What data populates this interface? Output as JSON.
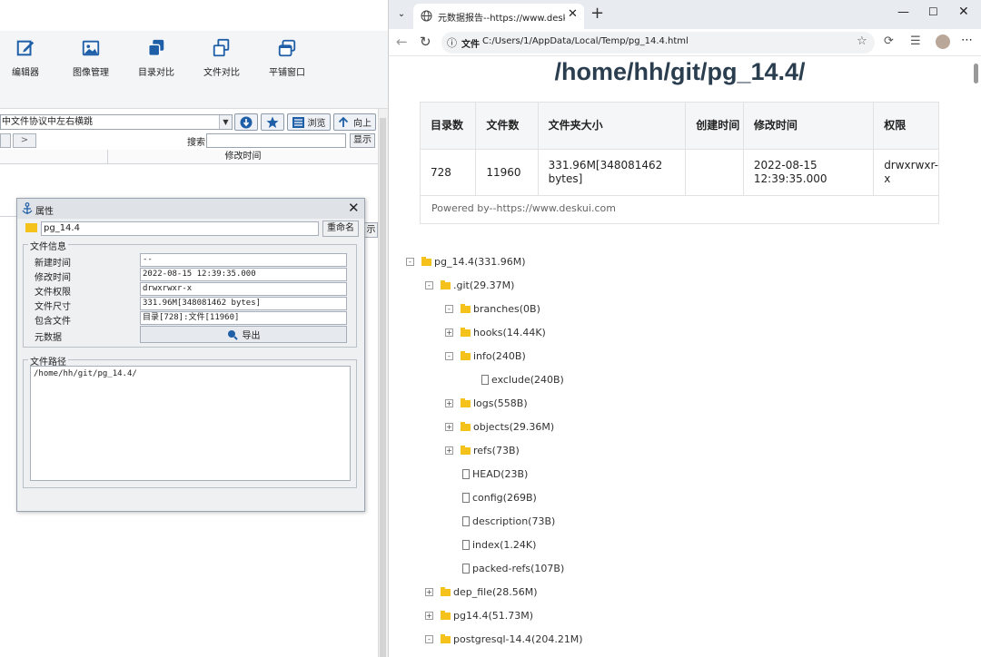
{
  "left_app": {
    "ribbon": [
      {
        "label": "编辑器",
        "icon": "edit-icon"
      },
      {
        "label": "图像管理",
        "icon": "image-icon"
      },
      {
        "label": "目录对比",
        "icon": "folder-compare-icon"
      },
      {
        "label": "文件对比",
        "icon": "file-compare-icon"
      },
      {
        "label": "平铺窗口",
        "icon": "tile-windows-icon"
      }
    ],
    "path_combo": "中文件协议中左右横跳",
    "browse_label": "浏览",
    "up_label": "向上",
    "search_label": "搜索",
    "show_label": "显示",
    "col_modify_time": "修改时间"
  },
  "dialog": {
    "title": "属性",
    "name_value": "pg_14.4",
    "rename_label": "重命名",
    "info_legend": "文件信息",
    "fields": [
      {
        "label": "新建时间",
        "value": "--"
      },
      {
        "label": "修改时间",
        "value": "2022-08-15 12:39:35.000"
      },
      {
        "label": "文件权限",
        "value": "drwxrwxr-x"
      },
      {
        "label": "文件尺寸",
        "value": "331.96M[348081462 bytes]"
      },
      {
        "label": "包含文件",
        "value": "目录[728]:文件[11960]"
      }
    ],
    "metadata_label": "元数据",
    "export_label": "导出",
    "path_legend": "文件路径",
    "path_value": "/home/hh/git/pg_14.4/",
    "side_btn_label": "示"
  },
  "browser": {
    "tab_title": "元数据报告--https://www.deskui.c",
    "address_label": "文件",
    "address": "C:/Users/1/AppData/Local/Temp/pg_14.4.html"
  },
  "report": {
    "heading": "/home/hh/git/pg_14.4/",
    "headers": [
      "目录数",
      "文件数",
      "文件夹大小",
      "创建时间",
      "修改时间",
      "权限"
    ],
    "values": [
      "728",
      "11960",
      "331.96M[348081462 bytes]",
      "",
      "2022-08-15 12:39:35.000",
      "drwxrwxr-x"
    ],
    "powered_by": "Powered by--https://www.deskui.com"
  },
  "tree": [
    {
      "type": "folder",
      "toggle": "-",
      "name": "pg_14.4",
      "size": "(331.96M)"
    },
    {
      "type": "folder",
      "toggle": "-",
      "name": ".git",
      "size": "(29.37M)"
    },
    {
      "type": "folder",
      "toggle": "-",
      "name": "branches",
      "size": "(0B)"
    },
    {
      "type": "folder",
      "toggle": "+",
      "name": "hooks",
      "size": "(14.44K)"
    },
    {
      "type": "folder",
      "toggle": "-",
      "name": "info",
      "size": "(240B)"
    },
    {
      "type": "file",
      "toggle": "",
      "name": "exclude",
      "size": "(240B)"
    },
    {
      "type": "folder",
      "toggle": "+",
      "name": "logs",
      "size": "(558B)"
    },
    {
      "type": "folder",
      "toggle": "+",
      "name": "objects",
      "size": "(29.36M)"
    },
    {
      "type": "folder",
      "toggle": "+",
      "name": "refs",
      "size": "(73B)"
    },
    {
      "type": "file",
      "toggle": "",
      "name": "HEAD",
      "size": "(23B)"
    },
    {
      "type": "file",
      "toggle": "",
      "name": "config",
      "size": "(269B)"
    },
    {
      "type": "file",
      "toggle": "",
      "name": "description",
      "size": "(73B)"
    },
    {
      "type": "file",
      "toggle": "",
      "name": "index",
      "size": "(1.24K)"
    },
    {
      "type": "file",
      "toggle": "",
      "name": "packed-refs",
      "size": "(107B)"
    },
    {
      "type": "folder",
      "toggle": "+",
      "name": "dep_file",
      "size": "(28.56M)"
    },
    {
      "type": "folder",
      "toggle": "+",
      "name": "pg14.4",
      "size": "(51.73M)"
    },
    {
      "type": "folder",
      "toggle": "-",
      "name": "postgresql-14.4",
      "size": "(204.21M)"
    }
  ],
  "colors": {
    "folder": "#f5c21b",
    "accent_blue": "#1f5fa8",
    "heading": "#2b3e50"
  }
}
